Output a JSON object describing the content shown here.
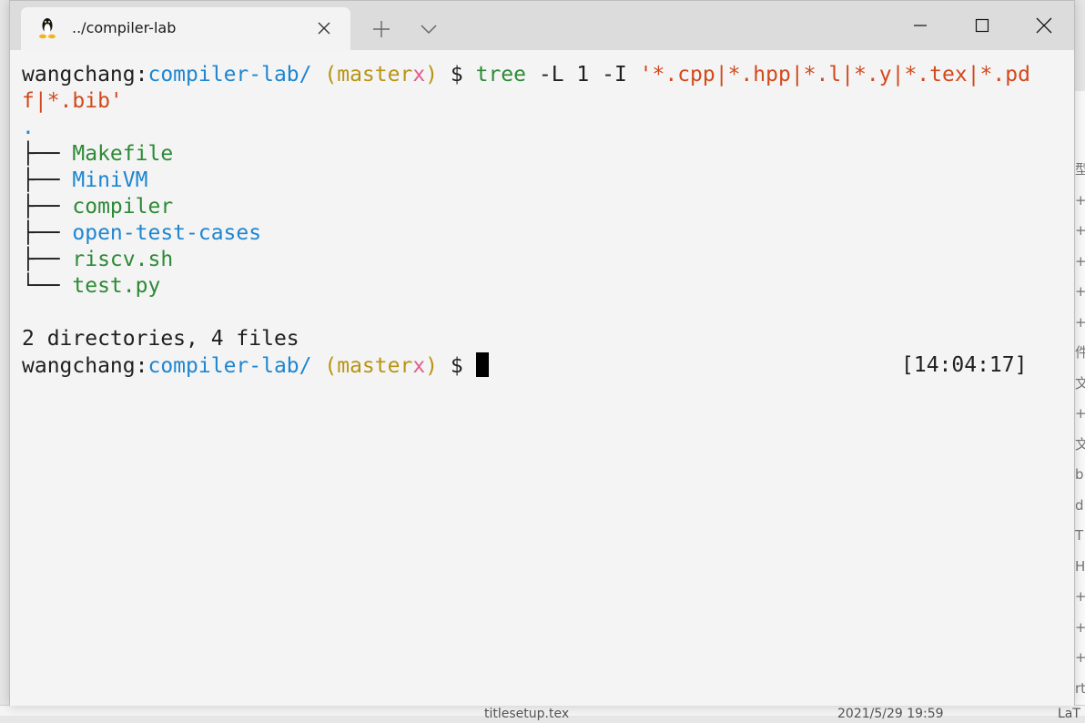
{
  "window": {
    "tab_title": "../compiler-lab",
    "icon": "linux-penguin-icon"
  },
  "terminal": {
    "user": "wangchang",
    "colon": ":",
    "dir": "compiler-lab/",
    "branch_open": "(",
    "branch": "master",
    "branch_mark": "x",
    "branch_close": ")",
    "prompt": "$",
    "cmd_name": "tree",
    "cmd_args": "-L 1 -I",
    "cmd_pattern_1": "'*.cpp|*.hpp|*.l|*.y|*.tex|*.pd",
    "cmd_pattern_2": "f|*.bib'",
    "tree_root": ".",
    "entries": [
      {
        "branch": "├── ",
        "name": "Makefile",
        "kind": "file"
      },
      {
        "branch": "├── ",
        "name": "MiniVM",
        "kind": "dir"
      },
      {
        "branch": "├── ",
        "name": "compiler",
        "kind": "file"
      },
      {
        "branch": "├── ",
        "name": "open-test-cases",
        "kind": "dir"
      },
      {
        "branch": "├── ",
        "name": "riscv.sh",
        "kind": "file"
      },
      {
        "branch": "└── ",
        "name": "test.py",
        "kind": "file"
      }
    ],
    "summary": "2 directories, 4 files",
    "timestamp": "[14:04:17]"
  },
  "background": {
    "bottom_file": "titlesetup.tex",
    "bottom_date": "2021/5/29 19:59",
    "bottom_type": "LaT",
    "side_chars": [
      "型",
      "+",
      "+",
      "+",
      "+",
      "+",
      "件",
      "文",
      "+",
      "文",
      "b",
      "d",
      "T",
      "H",
      "+",
      "+",
      "+",
      "rt"
    ]
  },
  "colors": {
    "blue": "#1e86d0",
    "yellow": "#b89414",
    "green": "#2c8a35",
    "orange": "#d2491b",
    "pink": "#e05d8f"
  }
}
